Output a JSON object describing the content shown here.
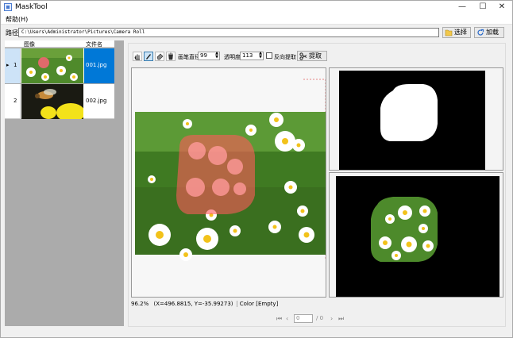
{
  "window": {
    "title": "MaskTool",
    "controls": [
      "—",
      "☐",
      "✕"
    ]
  },
  "menu": {
    "help": "帮助(H)"
  },
  "pathbar": {
    "label": "路径",
    "path": "C:\\Users\\Administrator\\Pictures\\Camera Roll",
    "select_btn": "选择",
    "load_btn": "加载"
  },
  "grid": {
    "headers": {
      "image": "图像",
      "filename": "文件名"
    },
    "rows": [
      {
        "index": "1",
        "marker": "▸",
        "filename": "001.jpg",
        "selected": true
      },
      {
        "index": "2",
        "marker": "",
        "filename": "002.jpg",
        "selected": false
      }
    ]
  },
  "toolbar": {
    "brush_diameter_label": "画笔直径",
    "brush_diameter_value": "99",
    "opacity_label": "透明度",
    "opacity_value": "113",
    "invert_label": "反向提取",
    "extract_label": "提取"
  },
  "status": {
    "zoom": "96.2%",
    "coords": "(X=496.8815, Y=-35.99273)",
    "color": "Color [Empty]"
  },
  "pager": {
    "current": "0",
    "total": "/ 0"
  },
  "colors": {
    "selection": "#0078d7",
    "mask_overlay": "#ff5a5a"
  }
}
